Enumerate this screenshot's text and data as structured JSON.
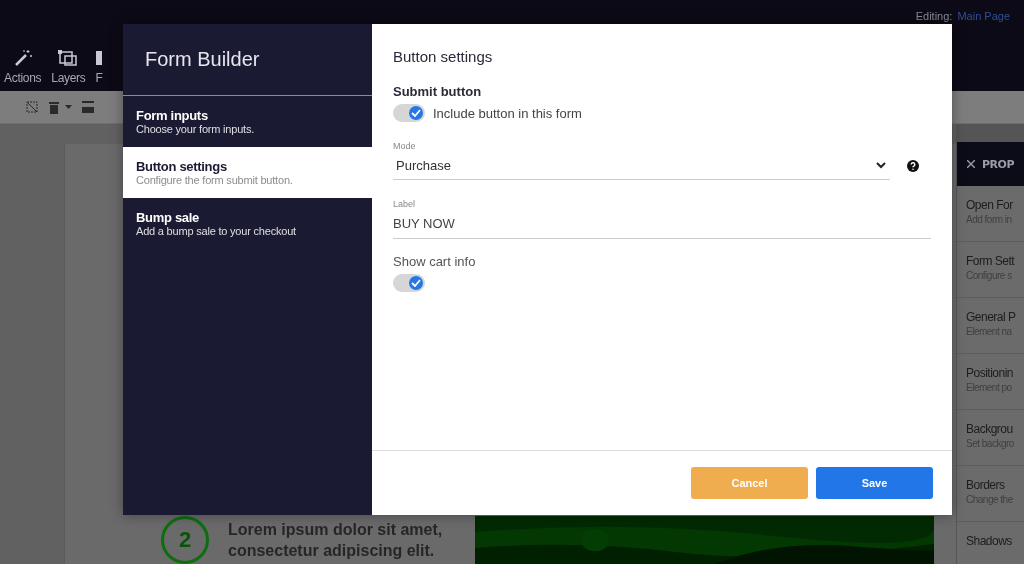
{
  "top_bar": {
    "editing_label": "Editing:",
    "page_link": "Main Page",
    "tools": [
      {
        "kind": "wand",
        "label": "Actions"
      },
      {
        "kind": "layers",
        "label": "Layers"
      },
      {
        "kind": "other",
        "label": "F"
      }
    ]
  },
  "canvas": {
    "step_number": "2",
    "step_text": "Lorem ipsum dolor sit amet, consectetur adipiscing elit."
  },
  "properties_panel": {
    "title": "PROP",
    "items": [
      {
        "title": "Open For",
        "subtitle": "Add form in"
      },
      {
        "title": "Form Sett",
        "subtitle": "Configure s"
      },
      {
        "title": "General P",
        "subtitle": "Element na"
      },
      {
        "title": "Positionin",
        "subtitle": "Element po"
      },
      {
        "title": "Backgrou",
        "subtitle": "Set backgro"
      },
      {
        "title": "Borders",
        "subtitle": "Change the"
      },
      {
        "title": "Shadows"
      }
    ]
  },
  "dialog": {
    "title": "Form Builder",
    "nav": [
      {
        "title": "Form inputs",
        "subtitle": "Choose your form inputs.",
        "selected": false
      },
      {
        "title": "Button settings",
        "subtitle": "Configure the form submit button.",
        "selected": true
      },
      {
        "title": "Bump sale",
        "subtitle": "Add a bump sale to your checkout",
        "selected": false
      }
    ],
    "heading": "Button settings",
    "section": "Submit button",
    "include_toggle": {
      "label": "Include button in this form",
      "on": true
    },
    "mode": {
      "label": "Mode",
      "value": "Purchase"
    },
    "label_field": {
      "label": "Label",
      "value": "BUY NOW"
    },
    "cart_toggle": {
      "label": "Show cart info",
      "on": true
    },
    "buttons": [
      {
        "kind": "cancel",
        "label": "Cancel"
      },
      {
        "kind": "save",
        "label": "Save"
      }
    ]
  }
}
